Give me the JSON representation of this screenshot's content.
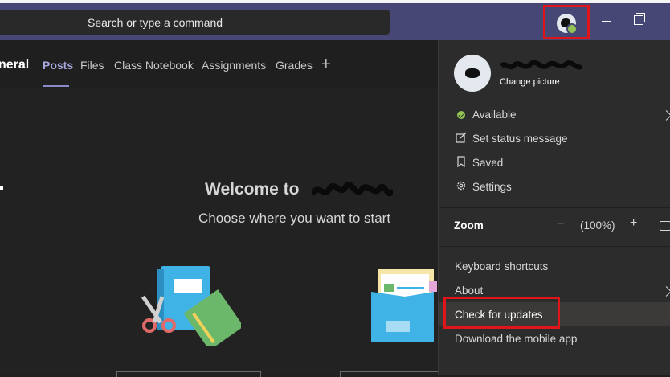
{
  "search": {
    "placeholder": "Search or type a command"
  },
  "tabs": {
    "channel": "neral",
    "items": [
      "Posts",
      "Files",
      "Class Notebook",
      "Assignments",
      "Grades"
    ],
    "add": "+"
  },
  "main": {
    "welcome": "Welcome to",
    "subtitle": "Choose where you want to start"
  },
  "profile_menu": {
    "change_picture": "Change picture",
    "status": "Available",
    "set_status": "Set status message",
    "saved": "Saved",
    "settings": "Settings",
    "zoom_label": "Zoom",
    "zoom_minus": "−",
    "zoom_value": "(100%)",
    "zoom_plus": "+",
    "keyboard_shortcuts": "Keyboard shortcuts",
    "about": "About",
    "check_updates": "Check for updates",
    "download_mobile": "Download the mobile app"
  },
  "colors": {
    "titlebar": "#464775",
    "accent_tab": "#a6a7dc",
    "available_green": "#92c353",
    "highlight_red": "#e0151a",
    "menu_bg": "#2d2c2c"
  },
  "icons": [
    "search-icon",
    "minimize-icon",
    "restore-icon",
    "status-available-icon",
    "edit-status-icon",
    "bookmark-icon",
    "gear-icon",
    "fullscreen-icon",
    "chevron-right-icon"
  ]
}
